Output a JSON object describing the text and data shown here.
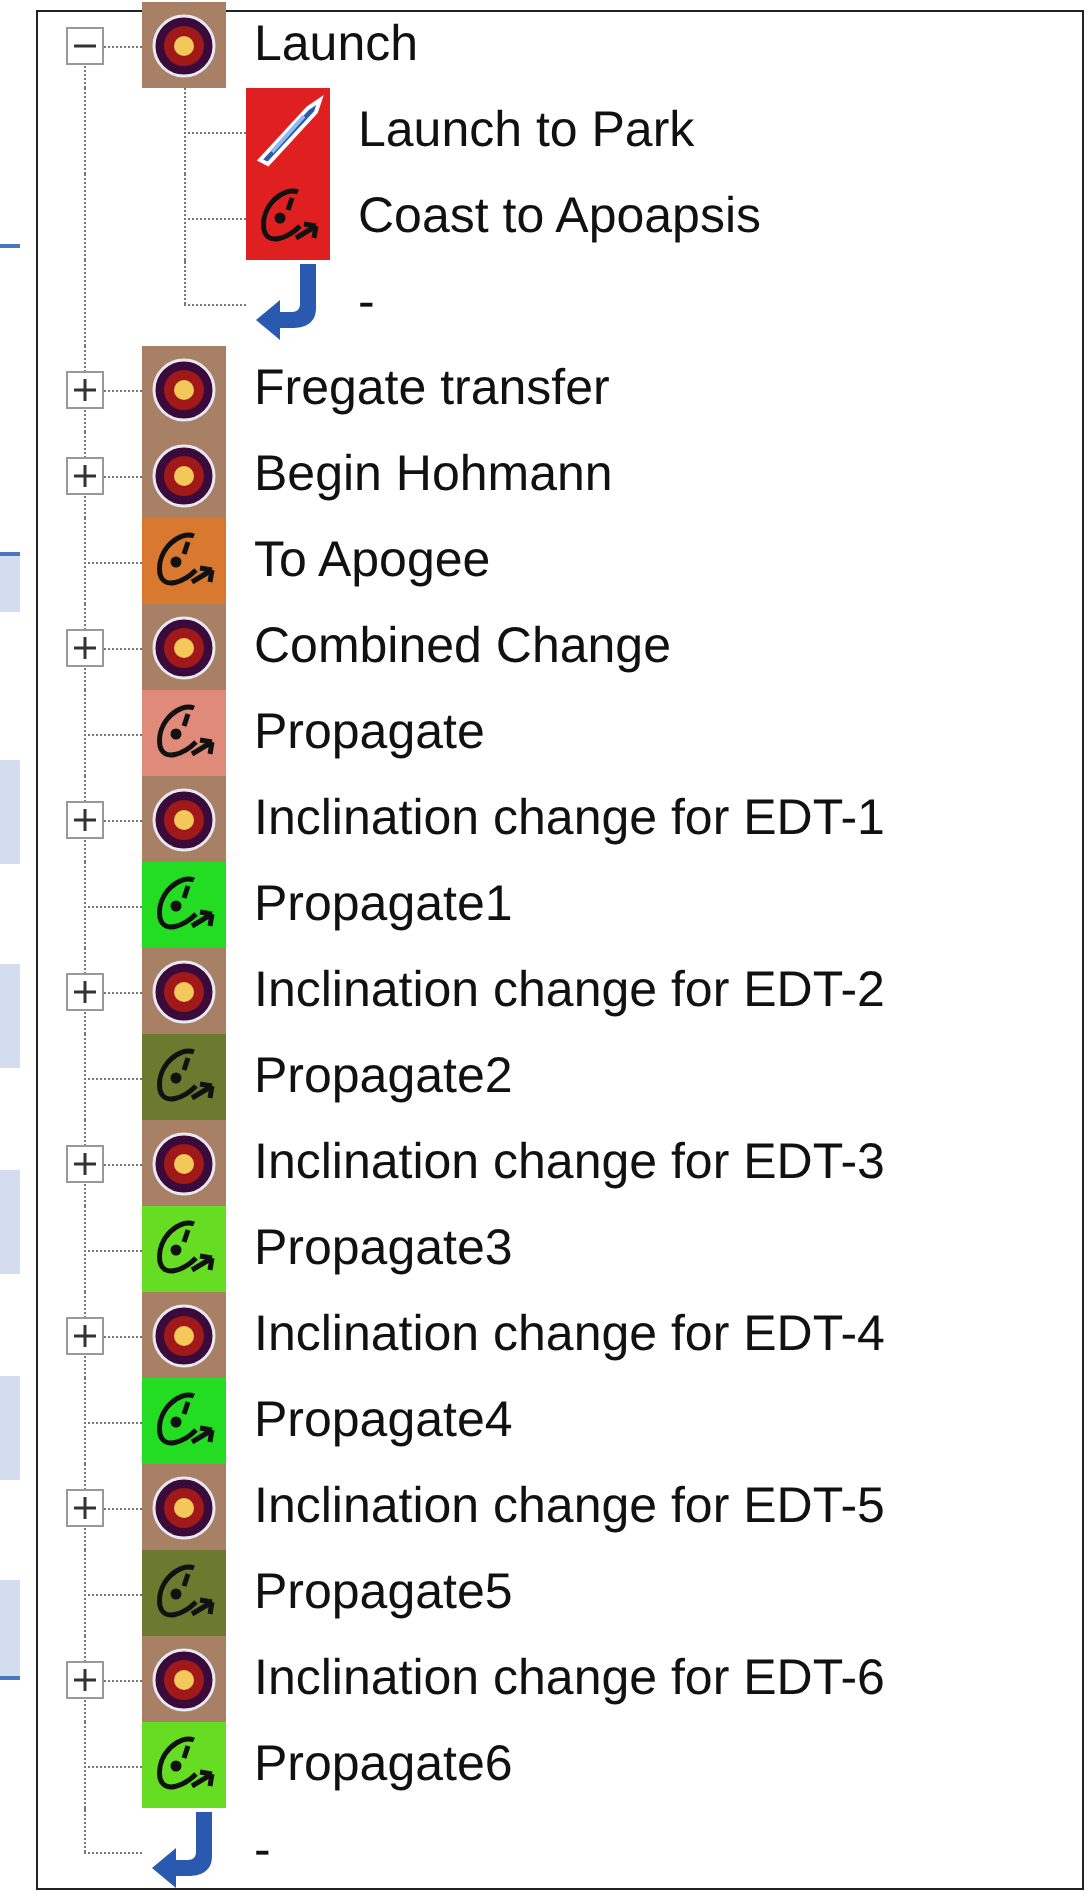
{
  "tree": {
    "items": [
      {
        "kind": "maneuver",
        "label": "Launch",
        "expanded": true,
        "children": [
          {
            "kind": "launch",
            "label": "Launch to Park",
            "color": "#e02020"
          },
          {
            "kind": "propagate",
            "label": "Coast to Apoapsis",
            "color": "#e02020"
          },
          {
            "kind": "return",
            "label": "-"
          }
        ]
      },
      {
        "kind": "maneuver",
        "label": "Fregate transfer",
        "expanded": false
      },
      {
        "kind": "maneuver",
        "label": "Begin Hohmann",
        "expanded": false
      },
      {
        "kind": "propagate",
        "label": "To Apogee",
        "color": "#d9792f"
      },
      {
        "kind": "maneuver",
        "label": "Combined Change",
        "expanded": false
      },
      {
        "kind": "propagate",
        "label": "Propagate",
        "color": "#e08a7a"
      },
      {
        "kind": "maneuver",
        "label": "Inclination change for EDT-1",
        "expanded": false
      },
      {
        "kind": "propagate",
        "label": "Propagate1",
        "color": "#22dd22"
      },
      {
        "kind": "maneuver",
        "label": "Inclination change for EDT-2",
        "expanded": false
      },
      {
        "kind": "propagate",
        "label": "Propagate2",
        "color": "#6b7a2e"
      },
      {
        "kind": "maneuver",
        "label": "Inclination change for EDT-3",
        "expanded": false
      },
      {
        "kind": "propagate",
        "label": "Propagate3",
        "color": "#66dd22"
      },
      {
        "kind": "maneuver",
        "label": "Inclination change for EDT-4",
        "expanded": false
      },
      {
        "kind": "propagate",
        "label": "Propagate4",
        "color": "#22dd22"
      },
      {
        "kind": "maneuver",
        "label": "Inclination change for EDT-5",
        "expanded": false
      },
      {
        "kind": "propagate",
        "label": "Propagate5",
        "color": "#6b7a2e"
      },
      {
        "kind": "maneuver",
        "label": "Inclination change for EDT-6",
        "expanded": false
      },
      {
        "kind": "propagate",
        "label": "Propagate6",
        "color": "#66dd22"
      },
      {
        "kind": "return",
        "label": "-"
      }
    ]
  }
}
